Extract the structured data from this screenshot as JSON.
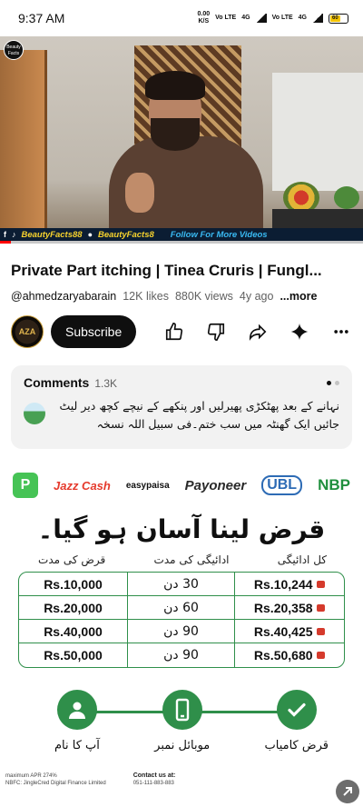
{
  "status_bar": {
    "time": "9:37 AM",
    "net_speed": "0.00",
    "net_unit": "K/S",
    "sim1": "Vo LTE",
    "sim1_net": "4G",
    "sim2": "Vo LTE",
    "sim2_net": "4G",
    "battery": "60"
  },
  "video": {
    "channel_badge": "Beauty Facts",
    "ticker": [
      "BeautyFacts88",
      "BeautyFacts8",
      "Follow For More Videos"
    ],
    "progress_fraction": 0.03
  },
  "details": {
    "title": "Private Part itching | Tinea Cruris | Fungl...",
    "handle": "@ahmedzaryabarain",
    "likes": "12K likes",
    "views": "880K views",
    "age": "4y ago",
    "more": "...more"
  },
  "actions": {
    "avatar_text": "AZA",
    "subscribe": "Subscribe",
    "icons": [
      "like-icon",
      "dislike-icon",
      "share-icon",
      "sparkle-icon",
      "more-vert-icon"
    ]
  },
  "comments": {
    "label": "Comments",
    "count": "1.3K",
    "top_comment": "نہانے کے بعد پھٹکڑی پھیرلیں اور پنکھے کے نیچے کچھ دیر لیٹ جائیں ایک گھنٹہ میں سب ختم۔فی سبیل اللہ نسخہ"
  },
  "ad": {
    "brands": [
      "Jazz Cash",
      "easypaisa",
      "Payoneer",
      "UBL",
      "NBP"
    ],
    "headline": "قرض لینا آسان ہو گیا۔",
    "col_heads": [
      "قرض کی مدت",
      "ادائیگی کی مدت",
      "کل ادائیگی"
    ],
    "rows": [
      {
        "amount": "Rs.10,000",
        "duration": "30 دن",
        "total": "Rs.10,244"
      },
      {
        "amount": "Rs.20,000",
        "duration": "60 دن",
        "total": "Rs.20,358"
      },
      {
        "amount": "Rs.40,000",
        "duration": "90 دن",
        "total": "Rs.40,425"
      },
      {
        "amount": "Rs.50,000",
        "duration": "90 دن",
        "total": "Rs.50,680"
      }
    ],
    "steps": [
      "آپ کا نام",
      "موبائل نمبر",
      "قرض کامیاب"
    ],
    "fine_print": {
      "apr": "maximum APR 274%",
      "nbfc": "NBFC: JingleCred Digital Finance Limited",
      "contact_label": "Contact us at:",
      "phone": "051-111-883-883"
    }
  }
}
